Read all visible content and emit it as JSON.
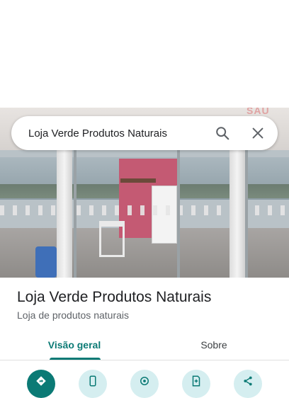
{
  "search": {
    "query": "Loja Verde Produtos Naturais",
    "search_icon": "search-icon",
    "close_icon": "close-icon"
  },
  "photo": {
    "sign_text": "SAÚ"
  },
  "place": {
    "name": "Loja Verde Produtos Naturais",
    "category": "Loja de produtos naturais"
  },
  "tabs": [
    {
      "label": "Visão geral",
      "selected": true
    },
    {
      "label": "Sobre",
      "selected": false
    }
  ],
  "actions": [
    {
      "icon": "directions-icon"
    },
    {
      "icon": "phone-icon"
    },
    {
      "icon": "location-icon"
    },
    {
      "icon": "save-icon"
    },
    {
      "icon": "share-icon"
    }
  ],
  "colors": {
    "accent": "#0b7a75",
    "action_bg": "#d5eef0",
    "title_text": "#202124",
    "secondary_text": "#5f6368"
  }
}
